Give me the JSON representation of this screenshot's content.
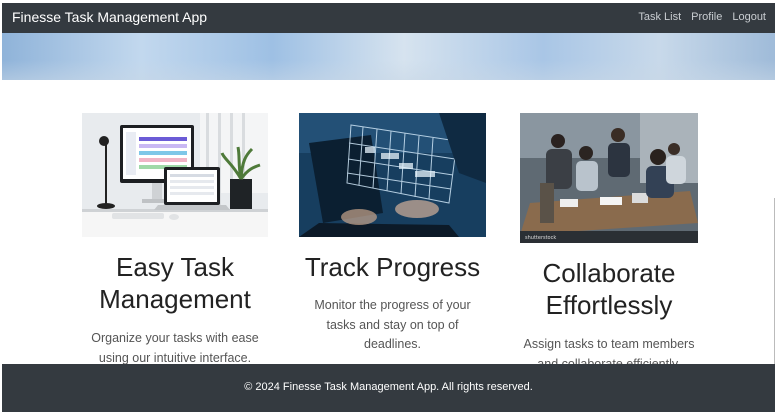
{
  "navbar": {
    "brand": "Finesse Task Management App",
    "links": [
      "Task List",
      "Profile",
      "Logout"
    ]
  },
  "features": [
    {
      "title_lines": [
        "Easy Task",
        "Management"
      ],
      "text_lines": [
        "Organize your tasks with ease",
        "using our intuitive interface."
      ],
      "image": "desk-computers-photo"
    },
    {
      "title_lines": [
        "Track Progress"
      ],
      "text_lines": [
        "Monitor the progress of your",
        "tasks and stay on top of",
        "deadlines."
      ],
      "image": "laptop-chart-photo"
    },
    {
      "title_lines": [
        "Collaborate",
        "Effortlessly"
      ],
      "text_lines": [
        "Assign tasks to team members",
        "and collaborate efficiently."
      ],
      "image": "team-meeting-photo",
      "watermark": "shutterstock"
    }
  ],
  "footer": {
    "text": "© 2024 Finesse Task Management App. All rights reserved."
  },
  "colors": {
    "navbar_bg": "#343a40",
    "footer_bg": "#343a40",
    "nav_link": "#c9cdd1"
  }
}
